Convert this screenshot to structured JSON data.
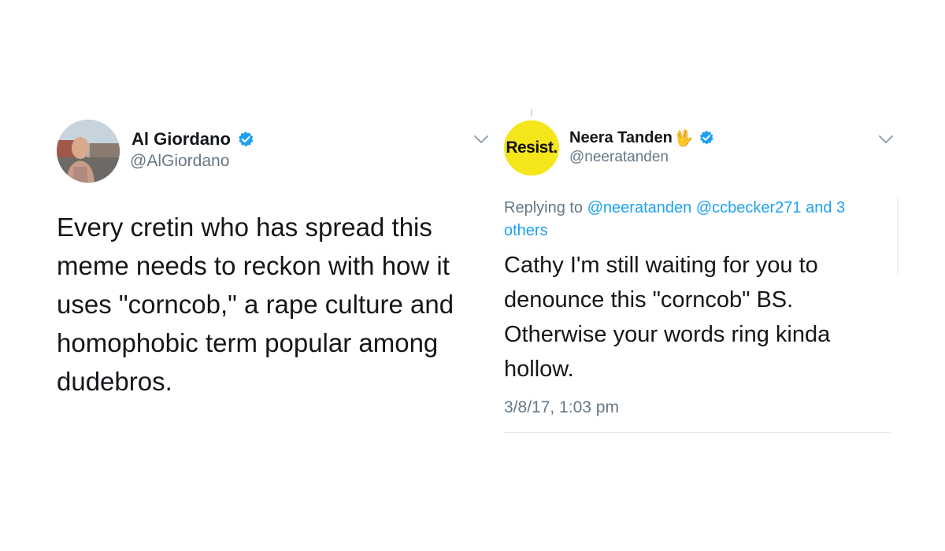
{
  "left_tweet": {
    "display_name": "Al Giordano",
    "handle": "@AlGiordano",
    "text_lines": [
      "Every cretin who has spread this",
      "meme needs to reckon with how it",
      "uses \"corncob,\" a rape culture and",
      "homophobic term popular among",
      "dudebros."
    ],
    "avatar_icon": "profile-photo",
    "verified_icon": "verified-badge-icon",
    "menu_icon": "chevron-down-icon"
  },
  "right_tweet": {
    "display_name": "Neera Tanden",
    "name_emoji": "🖖",
    "handle": "@neeratanden",
    "avatar_text": "Resist.",
    "avatar_color": "#f5e51b",
    "replying_prefix": "Replying to",
    "replying_mentions": [
      "@neeratanden",
      "@ccbecker271"
    ],
    "replying_and": "and",
    "replying_others": "3 others",
    "text_lines": [
      "Cathy I'm still waiting for you to",
      "denounce this \"corncob\" BS.",
      "Otherwise your words ring kinda",
      "hollow."
    ],
    "timestamp": "3/8/17, 1:03 pm",
    "verified_icon": "verified-badge-icon",
    "menu_icon": "chevron-down-icon"
  },
  "colors": {
    "verified": "#1da1f2",
    "link": "#1da1f2",
    "secondary_text": "#657786",
    "primary_text": "#14171a"
  }
}
